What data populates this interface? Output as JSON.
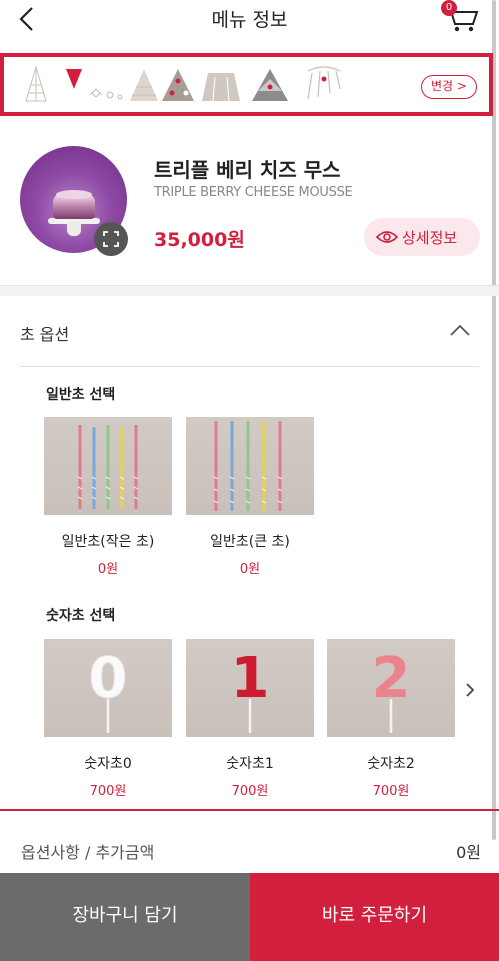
{
  "header": {
    "title": "메뉴 정보",
    "cart_count": "0"
  },
  "banner": {
    "change_label": "변경 >"
  },
  "product": {
    "name": "트리플 베리 치즈 무스",
    "name_en": "TRIPLE BERRY CHEESE MOUSSE",
    "price": "35,000원",
    "detail_label": "상세정보"
  },
  "options": {
    "title": "초 옵션",
    "groups": [
      {
        "title": "일반초 선택",
        "items": [
          {
            "name": "일반초(작은 초)",
            "price": "0원"
          },
          {
            "name": "일반초(큰 초)",
            "price": "0원"
          }
        ]
      },
      {
        "title": "숫자초 선택",
        "items": [
          {
            "name": "숫자초0",
            "price": "700원",
            "digit": "0"
          },
          {
            "name": "숫자초1",
            "price": "700원",
            "digit": "1"
          },
          {
            "name": "숫자초2",
            "price": "700원",
            "digit": "2"
          }
        ]
      }
    ]
  },
  "summary": {
    "label": "옵션사항 / 추가금액",
    "value": "0원"
  },
  "actions": {
    "cart_label": "장바구니 담기",
    "order_label": "바로 주문하기"
  },
  "colors": {
    "accent": "#d11f3d",
    "gray_button": "#6b6b6b"
  }
}
